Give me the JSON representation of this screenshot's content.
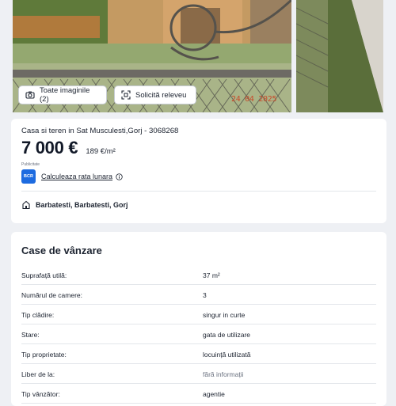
{
  "gallery": {
    "all_images_label": "Toate imaginile (2)",
    "survey_label": "Solicită releveu",
    "date_stamp": "24 04 2025",
    "icons": {
      "all_images": "camera-icon",
      "survey": "scan-icon"
    }
  },
  "listing": {
    "title": "Casa si teren in Sat Musculesti,Gorj - 3068268",
    "price": "7 000 €",
    "price_per_sqm": "189 €/m²",
    "ad_label": "Publicitate",
    "bank_logo_text": "BCR",
    "calc_link": "Calculeaza rata lunara",
    "location": "Barbatesti, Barbatesti, Gorj",
    "icons": {
      "info": "info-icon",
      "location": "location-pin-icon"
    }
  },
  "details": {
    "section_title": "Case de vânzare",
    "rows": [
      {
        "label": "Suprafață utilă:",
        "value": "37 m²"
      },
      {
        "label": "Numărul de camere:",
        "value": "3"
      },
      {
        "label": "Tip clădire:",
        "value": "singur in curte"
      },
      {
        "label": "Stare:",
        "value": "gata de utilizare"
      },
      {
        "label": "Tip proprietate:",
        "value": "locuință utilizată"
      },
      {
        "label": "Liber de la:",
        "value": "fără informații"
      },
      {
        "label": "Tip vânzător:",
        "value": "agentie"
      }
    ]
  },
  "colors": {
    "accent": "#1d6be0",
    "page_bg": "#eef0f4",
    "card_bg": "#ffffff"
  }
}
